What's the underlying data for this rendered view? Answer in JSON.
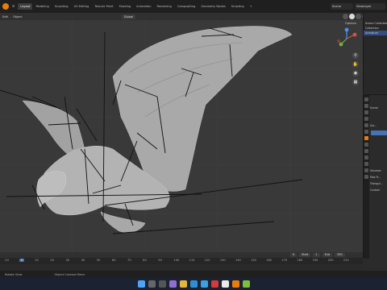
{
  "workspace_tabs": [
    "Layout",
    "Modeling",
    "Sculpting",
    "UV Editing",
    "Texture Paint",
    "Shading",
    "Animation",
    "Rendering",
    "Compositing",
    "Geometry Nodes",
    "Scripting"
  ],
  "add_workspace": "+",
  "scene_label": "Scene",
  "viewlayer_label": "ViewLayer",
  "viewport": {
    "menus": [
      "Edit",
      "Object"
    ],
    "orientation_label": "Global",
    "options_label": "Options"
  },
  "outliner": {
    "rows": [
      "Scene Collection",
      "Collection",
      "Armature"
    ]
  },
  "properties": {
    "rows": [
      "Scene",
      "Sur...",
      "Volumes",
      "Max Fr...",
      "Triangul...",
      "Custom"
    ]
  },
  "timeline": {
    "current_frame": "0",
    "start_label": "Start",
    "start_value": "1",
    "end_label": "End",
    "end_value": "250",
    "ticks": [
      "-10",
      "0",
      "10",
      "20",
      "30",
      "40",
      "50",
      "60",
      "70",
      "80",
      "90",
      "100",
      "110",
      "120",
      "130",
      "140",
      "150",
      "160",
      "170",
      "180",
      "190",
      "200",
      "210"
    ]
  },
  "status": {
    "left": "Rotate View",
    "middle": "Object Context Menu"
  },
  "colors": {
    "accent": "#e87d0d",
    "selection": "#4772b3",
    "viewport_bg": "#393939"
  }
}
